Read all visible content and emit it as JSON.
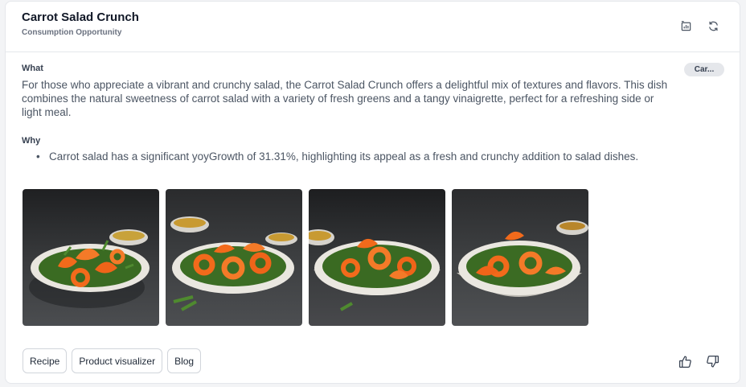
{
  "card": {
    "title": "Carrot Salad Crunch",
    "subtitle": "Consumption Opportunity",
    "tag": "Car...",
    "header_icons": [
      "chart-export-icon",
      "refresh-icon"
    ]
  },
  "what": {
    "label": "What",
    "text": "For those who appreciate a vibrant and crunchy salad, the Carrot Salad Crunch offers a delightful mix of textures and flavors. This dish combines the natural sweetness of carrot salad with a variety of fresh greens and a tangy vinaigrette, perfect for a refreshing side or light meal."
  },
  "why": {
    "label": "Why",
    "bullets": [
      "Carrot salad has a significant yoyGrowth of 31.31%, highlighting its appeal as a fresh and crunchy addition to salad dishes."
    ]
  },
  "images": {
    "count": 4,
    "subject": "carrot-salad-photo"
  },
  "actions": {
    "recipe": "Recipe",
    "product_visualizer": "Product visualizer",
    "blog": "Blog"
  },
  "feedback_icons": [
    "thumbs-up-icon",
    "thumbs-down-icon"
  ],
  "colors": {
    "carrot": "#f26a1b",
    "greens": "#3f7a2a",
    "background": "#2f3133"
  }
}
